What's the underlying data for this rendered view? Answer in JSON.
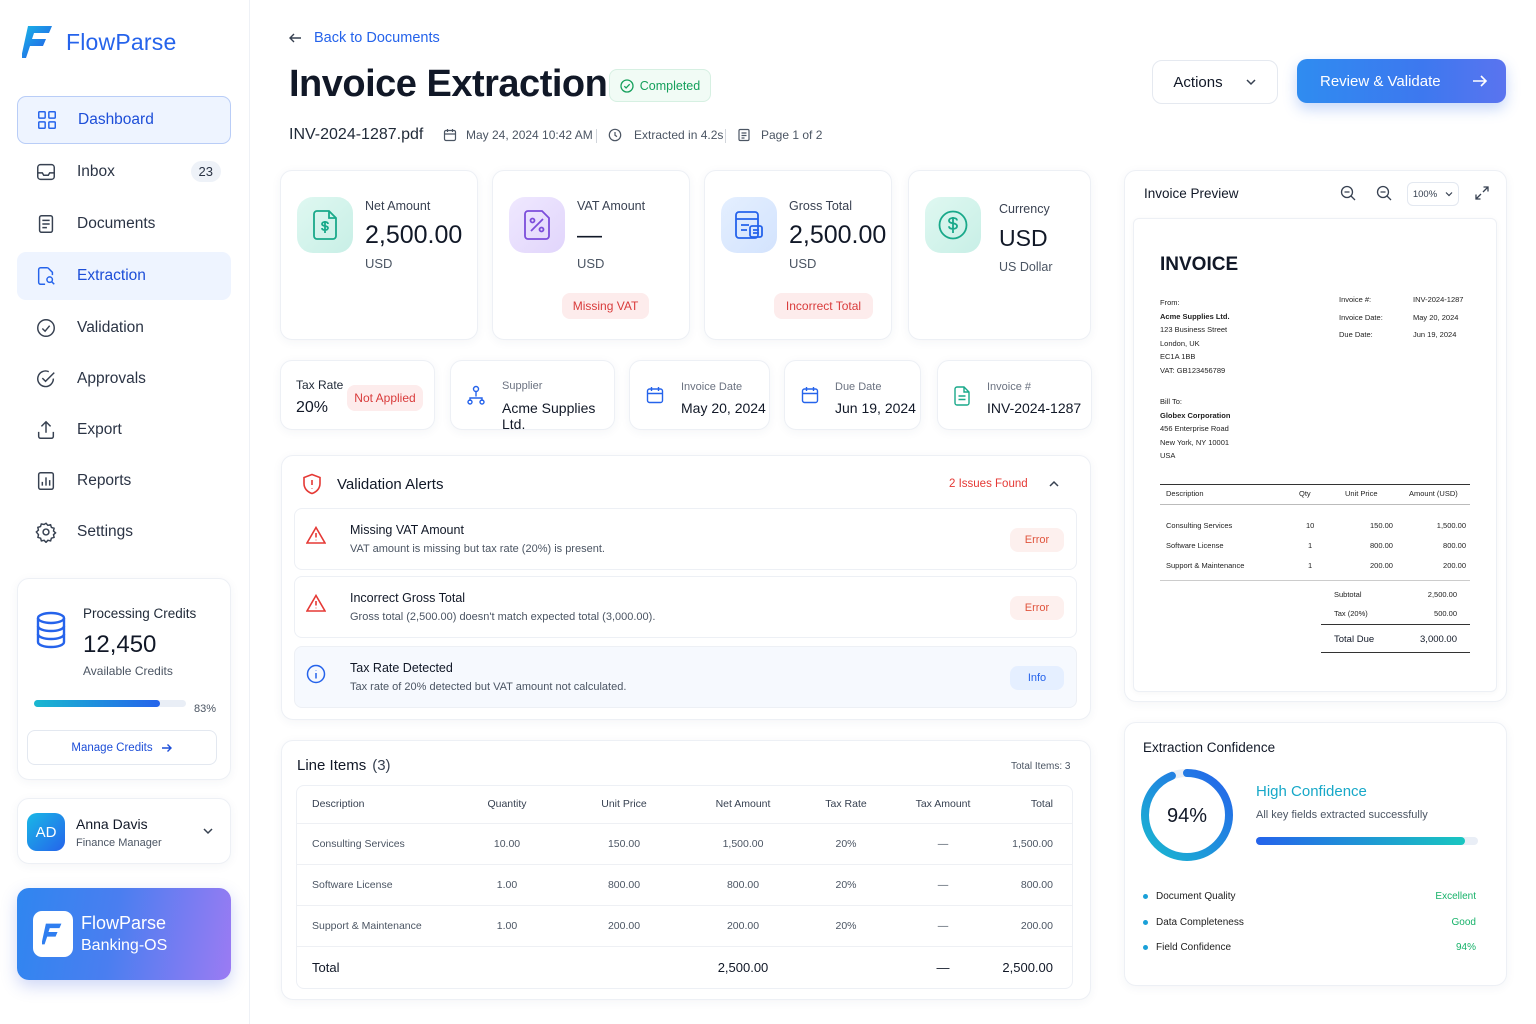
{
  "sidebar": {
    "brand": "FlowParse",
    "items": [
      {
        "label": "Dashboard"
      },
      {
        "label": "Inbox",
        "badge": "23"
      },
      {
        "label": "Documents"
      },
      {
        "label": "Extraction"
      },
      {
        "label": "Validation"
      },
      {
        "label": "Approvals"
      },
      {
        "label": "Export"
      },
      {
        "label": "Reports"
      },
      {
        "label": "Settings"
      }
    ],
    "credits": {
      "title": "Processing Credits",
      "value": "12,450",
      "subtitle": "Available Credits",
      "percent_label": "83%",
      "percent": 83,
      "manage_label": "Manage Credits"
    },
    "user": {
      "initials": "AD",
      "name": "Anna Davis",
      "role": "Finance Manager"
    },
    "promo": {
      "line1": "FlowParse",
      "line2": "Banking-OS"
    }
  },
  "header": {
    "back_label": "Back to Documents",
    "title": "Invoice Extraction",
    "status": "Completed",
    "filename": "INV-2024-1287.pdf",
    "date": "May 24, 2024 10:42 AM",
    "extracted": "Extracted in 4.2s",
    "page": "Page 1 of 2",
    "actions_label": "Actions",
    "review_label": "Review & Validate"
  },
  "metrics": [
    {
      "label": "Net Amount",
      "value": "2,500.00",
      "unit": "USD"
    },
    {
      "label": "VAT Amount",
      "value": "—",
      "unit": "USD",
      "flag": "Missing VAT"
    },
    {
      "label": "Gross Total",
      "value": "2,500.00",
      "unit": "USD",
      "flag": "Incorrect Total"
    },
    {
      "label": "Currency",
      "value": "USD",
      "unit": "US Dollar"
    }
  ],
  "fields": {
    "tax": {
      "label": "Tax Rate",
      "value": "20%",
      "flag": "Not Applied"
    },
    "supplier": {
      "label": "Supplier",
      "value": "Acme Supplies Ltd."
    },
    "invoice_date": {
      "label": "Invoice Date",
      "value": "May 20, 2024"
    },
    "due_date": {
      "label": "Due Date",
      "value": "Jun 19, 2024"
    },
    "invoice_no": {
      "label": "Invoice #",
      "value": "INV-2024-1287"
    }
  },
  "alerts": {
    "title": "Validation Alerts",
    "count_label": "2 Issues Found",
    "items": [
      {
        "title": "Missing VAT Amount",
        "desc": "VAT amount is missing but tax rate (20%) is present.",
        "level": "Error"
      },
      {
        "title": "Incorrect Gross Total",
        "desc": "Gross total (2,500.00) doesn't match expected total (3,000.00).",
        "level": "Error"
      },
      {
        "title": "Tax Rate Detected",
        "desc": "Tax rate of 20% detected but VAT amount not calculated.",
        "level": "Info"
      }
    ]
  },
  "line_items": {
    "title": "Line Items",
    "count": "(3)",
    "total_items": "Total Items: 3",
    "columns": [
      "Description",
      "Quantity",
      "Unit Price",
      "Net Amount",
      "Tax Rate",
      "Tax Amount",
      "Total"
    ],
    "rows": [
      [
        "Consulting Services",
        "10.00",
        "150.00",
        "1,500.00",
        "20%",
        "—",
        "1,500.00"
      ],
      [
        "Software License",
        "1.00",
        "800.00",
        "800.00",
        "20%",
        "—",
        "800.00"
      ],
      [
        "Support & Maintenance",
        "1.00",
        "200.00",
        "200.00",
        "20%",
        "—",
        "200.00"
      ]
    ],
    "total": {
      "label": "Total",
      "net": "2,500.00",
      "tax": "—",
      "total": "2,500.00"
    }
  },
  "preview": {
    "title": "Invoice Preview",
    "zoom": "100%",
    "doc": {
      "heading": "INVOICE",
      "from_label": "From:",
      "from": [
        "Acme Supplies Ltd.",
        "123 Business Street",
        "London, UK",
        "EC1A 1BB",
        "VAT: GB123456789"
      ],
      "billto_label": "Bill To:",
      "billto": [
        "Globex Corporation",
        "456 Enterprise Road",
        "New York, NY 10001",
        "USA"
      ],
      "meta": [
        {
          "k": "Invoice #:",
          "v": "INV-2024-1287"
        },
        {
          "k": "Invoice Date:",
          "v": "May 20, 2024"
        },
        {
          "k": "Due Date:",
          "v": "Jun 19, 2024"
        }
      ],
      "columns": [
        "Description",
        "Qty",
        "Unit Price",
        "Amount (USD)"
      ],
      "rows": [
        [
          "Consulting Services",
          "10",
          "150.00",
          "1,500.00"
        ],
        [
          "Software License",
          "1",
          "800.00",
          "800.00"
        ],
        [
          "Support & Maintenance",
          "1",
          "200.00",
          "200.00"
        ]
      ],
      "subtotal_label": "Subtotal",
      "subtotal": "2,500.00",
      "tax_label": "Tax (20%)",
      "tax": "500.00",
      "total_label": "Total Due",
      "total": "3,000.00"
    }
  },
  "confidence": {
    "title": "Extraction Confidence",
    "percent_label": "94%",
    "percent": 94,
    "headline": "High Confidence",
    "desc": "All key fields extracted successfully",
    "items": [
      {
        "label": "Document Quality",
        "value": "Excellent"
      },
      {
        "label": "Data Completeness",
        "value": "Good"
      },
      {
        "label": "Field Confidence",
        "value": "94%"
      }
    ]
  },
  "colors": {
    "primary": "#2563eb",
    "error": "#d93b3b",
    "success": "#17b26a",
    "accent_teal": "#19b8d0"
  }
}
